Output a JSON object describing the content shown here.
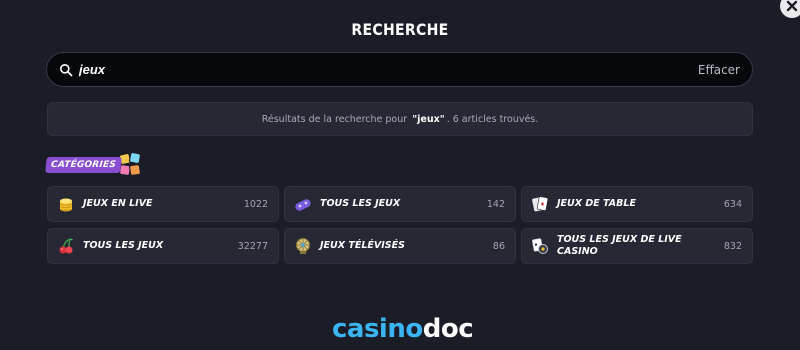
{
  "dialog": {
    "title": "RECHERCHE",
    "close_icon": "close-icon"
  },
  "search": {
    "value": "jeux",
    "clear_label": "Effacer",
    "icon": "search-icon"
  },
  "results": {
    "prefix": "Résultats de la recherche pour",
    "query": "\"jeux\"",
    "suffix": ". 6 articles trouvés."
  },
  "categories": {
    "label": "CATÉGORIES",
    "items": [
      {
        "label": "JEUX EN LIVE",
        "count": "1022",
        "icon": "coin-stack-icon"
      },
      {
        "label": "TOUS LES JEUX",
        "count": "142",
        "icon": "gamepad-icon"
      },
      {
        "label": "JEUX DE TABLE",
        "count": "634",
        "icon": "playing-cards-icon"
      },
      {
        "label": "TOUS LES JEUX",
        "count": "32277",
        "icon": "cherries-icon"
      },
      {
        "label": "JEUX TÉLÉVISÉS",
        "count": "86",
        "icon": "tv-wheel-icon"
      },
      {
        "label": "TOUS LES JEUX DE LIVE CASINO",
        "count": "832",
        "icon": "live-cards-icon"
      }
    ]
  },
  "footer": {
    "logo_part1": "casino",
    "logo_part2": "doc"
  },
  "colors": {
    "background": "#1b1d26",
    "card": "#262834",
    "accent_purple": "#8a4fd0",
    "logo_blue": "#3ab4f2"
  }
}
